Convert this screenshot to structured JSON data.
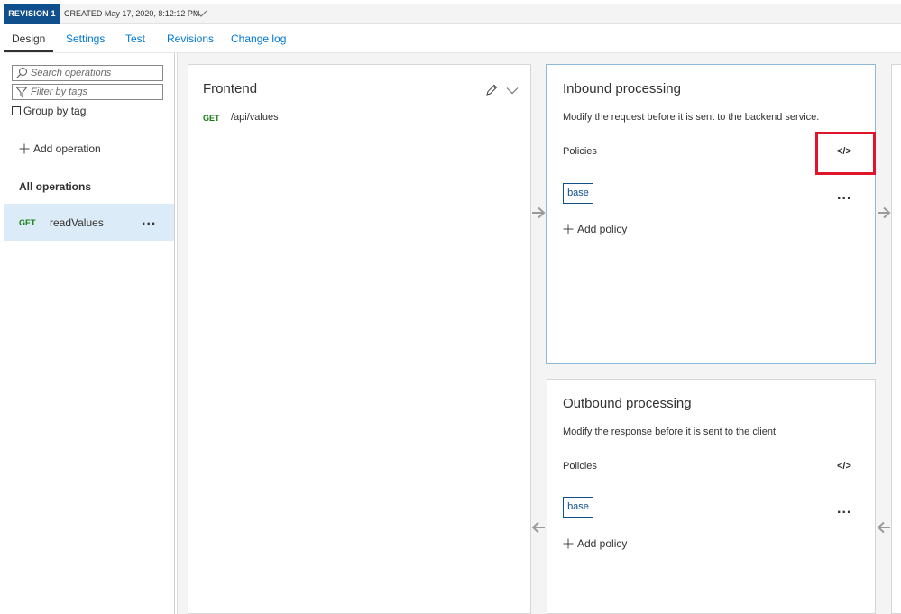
{
  "revision": {
    "badge": "REVISION 1",
    "created": "CREATED May 17, 2020, 8:12:12 PM"
  },
  "tabs": [
    {
      "label": "Design"
    },
    {
      "label": "Settings"
    },
    {
      "label": "Test"
    },
    {
      "label": "Revisions"
    },
    {
      "label": "Change log"
    }
  ],
  "sidebar": {
    "search_placeholder": "Search operations",
    "filter_placeholder": "Filter by tags",
    "group_by_tag": "Group by tag",
    "add_operation": "Add operation",
    "all_operations": "All operations",
    "operations": [
      {
        "method": "GET",
        "name": "readValues",
        "more": "..."
      }
    ]
  },
  "frontend": {
    "title": "Frontend",
    "method": "GET",
    "path": "/api/values"
  },
  "inbound": {
    "title": "Inbound processing",
    "description": "Modify the request before it is sent to the backend service.",
    "policies_label": "Policies",
    "code_icon": "</>",
    "base_label": "base",
    "more": "...",
    "add_policy": "Add policy"
  },
  "outbound": {
    "title": "Outbound processing",
    "description": "Modify the response before it is sent to the client.",
    "policies_label": "Policies",
    "code_icon": "</>",
    "base_label": "base",
    "more": "...",
    "add_policy": "Add policy"
  },
  "colors": {
    "accent": "#0078d4",
    "badge_bg": "#0f4f8c",
    "get_method": "#107c10",
    "highlight": "#e0142a",
    "selected_row": "#dcebf8"
  }
}
